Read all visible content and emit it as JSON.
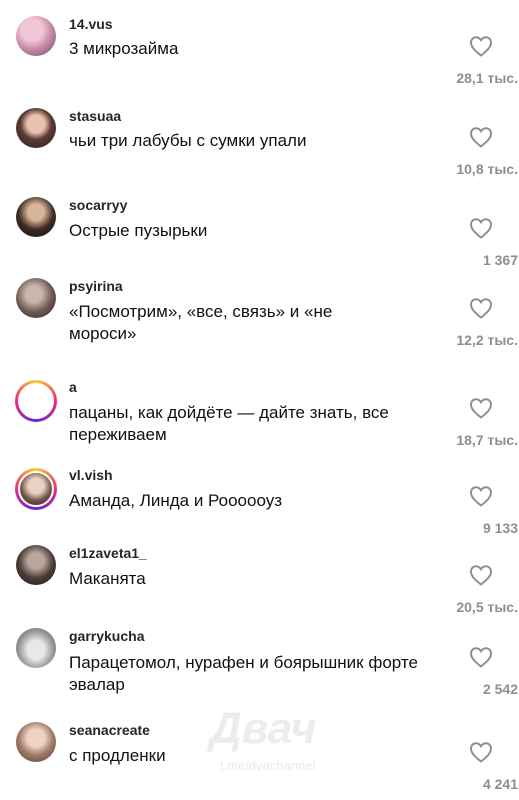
{
  "comments": [
    {
      "username": "14.vus",
      "text": "3 микрозайма",
      "likes": "28,1 тыс."
    },
    {
      "username": "stasuaa",
      "text": "чьи три лабубы с сумки упали",
      "likes": "10,8 тыс."
    },
    {
      "username": "socarryy",
      "text": "Острые пузырьки",
      "likes": "1 367"
    },
    {
      "username": "psyirina",
      "text": "«Посмотрим», «все, связь» и «не мороси»",
      "likes": "12,2 тыс."
    },
    {
      "username": "a",
      "text": "пацаны, как дойдёте — дайте знать, все переживаем",
      "likes": "18,7 тыс."
    },
    {
      "username": "vl.vish",
      "text": "Аманда, Линда и Роооооуз",
      "likes": "9 133"
    },
    {
      "username": "el1zaveta1_",
      "text": "Маканята",
      "likes": "20,5 тыс."
    },
    {
      "username": "garrykucha",
      "text": "Парацетомол, нурафен и боярышник форте эвалар",
      "likes": "2 542"
    },
    {
      "username": "seanacreate",
      "text": "с продленки",
      "likes": "4 241"
    }
  ],
  "watermark": {
    "logo": "Двач",
    "url": "t.me/dvachannel"
  },
  "icons": {
    "like": "heart-outline-icon"
  }
}
